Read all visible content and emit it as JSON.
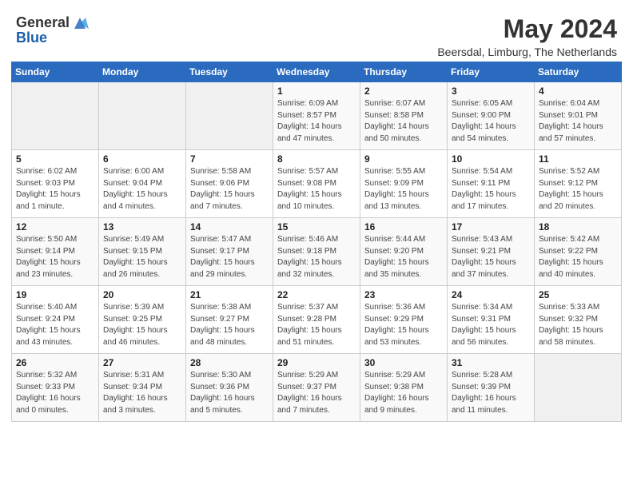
{
  "header": {
    "logo_general": "General",
    "logo_blue": "Blue",
    "month": "May 2024",
    "location": "Beersdal, Limburg, The Netherlands"
  },
  "weekdays": [
    "Sunday",
    "Monday",
    "Tuesday",
    "Wednesday",
    "Thursday",
    "Friday",
    "Saturday"
  ],
  "weeks": [
    [
      {
        "day": "",
        "sunrise": "",
        "sunset": "",
        "daylight": ""
      },
      {
        "day": "",
        "sunrise": "",
        "sunset": "",
        "daylight": ""
      },
      {
        "day": "",
        "sunrise": "",
        "sunset": "",
        "daylight": ""
      },
      {
        "day": "1",
        "sunrise": "Sunrise: 6:09 AM",
        "sunset": "Sunset: 8:57 PM",
        "daylight": "Daylight: 14 hours and 47 minutes."
      },
      {
        "day": "2",
        "sunrise": "Sunrise: 6:07 AM",
        "sunset": "Sunset: 8:58 PM",
        "daylight": "Daylight: 14 hours and 50 minutes."
      },
      {
        "day": "3",
        "sunrise": "Sunrise: 6:05 AM",
        "sunset": "Sunset: 9:00 PM",
        "daylight": "Daylight: 14 hours and 54 minutes."
      },
      {
        "day": "4",
        "sunrise": "Sunrise: 6:04 AM",
        "sunset": "Sunset: 9:01 PM",
        "daylight": "Daylight: 14 hours and 57 minutes."
      }
    ],
    [
      {
        "day": "5",
        "sunrise": "Sunrise: 6:02 AM",
        "sunset": "Sunset: 9:03 PM",
        "daylight": "Daylight: 15 hours and 1 minute."
      },
      {
        "day": "6",
        "sunrise": "Sunrise: 6:00 AM",
        "sunset": "Sunset: 9:04 PM",
        "daylight": "Daylight: 15 hours and 4 minutes."
      },
      {
        "day": "7",
        "sunrise": "Sunrise: 5:58 AM",
        "sunset": "Sunset: 9:06 PM",
        "daylight": "Daylight: 15 hours and 7 minutes."
      },
      {
        "day": "8",
        "sunrise": "Sunrise: 5:57 AM",
        "sunset": "Sunset: 9:08 PM",
        "daylight": "Daylight: 15 hours and 10 minutes."
      },
      {
        "day": "9",
        "sunrise": "Sunrise: 5:55 AM",
        "sunset": "Sunset: 9:09 PM",
        "daylight": "Daylight: 15 hours and 13 minutes."
      },
      {
        "day": "10",
        "sunrise": "Sunrise: 5:54 AM",
        "sunset": "Sunset: 9:11 PM",
        "daylight": "Daylight: 15 hours and 17 minutes."
      },
      {
        "day": "11",
        "sunrise": "Sunrise: 5:52 AM",
        "sunset": "Sunset: 9:12 PM",
        "daylight": "Daylight: 15 hours and 20 minutes."
      }
    ],
    [
      {
        "day": "12",
        "sunrise": "Sunrise: 5:50 AM",
        "sunset": "Sunset: 9:14 PM",
        "daylight": "Daylight: 15 hours and 23 minutes."
      },
      {
        "day": "13",
        "sunrise": "Sunrise: 5:49 AM",
        "sunset": "Sunset: 9:15 PM",
        "daylight": "Daylight: 15 hours and 26 minutes."
      },
      {
        "day": "14",
        "sunrise": "Sunrise: 5:47 AM",
        "sunset": "Sunset: 9:17 PM",
        "daylight": "Daylight: 15 hours and 29 minutes."
      },
      {
        "day": "15",
        "sunrise": "Sunrise: 5:46 AM",
        "sunset": "Sunset: 9:18 PM",
        "daylight": "Daylight: 15 hours and 32 minutes."
      },
      {
        "day": "16",
        "sunrise": "Sunrise: 5:44 AM",
        "sunset": "Sunset: 9:20 PM",
        "daylight": "Daylight: 15 hours and 35 minutes."
      },
      {
        "day": "17",
        "sunrise": "Sunrise: 5:43 AM",
        "sunset": "Sunset: 9:21 PM",
        "daylight": "Daylight: 15 hours and 37 minutes."
      },
      {
        "day": "18",
        "sunrise": "Sunrise: 5:42 AM",
        "sunset": "Sunset: 9:22 PM",
        "daylight": "Daylight: 15 hours and 40 minutes."
      }
    ],
    [
      {
        "day": "19",
        "sunrise": "Sunrise: 5:40 AM",
        "sunset": "Sunset: 9:24 PM",
        "daylight": "Daylight: 15 hours and 43 minutes."
      },
      {
        "day": "20",
        "sunrise": "Sunrise: 5:39 AM",
        "sunset": "Sunset: 9:25 PM",
        "daylight": "Daylight: 15 hours and 46 minutes."
      },
      {
        "day": "21",
        "sunrise": "Sunrise: 5:38 AM",
        "sunset": "Sunset: 9:27 PM",
        "daylight": "Daylight: 15 hours and 48 minutes."
      },
      {
        "day": "22",
        "sunrise": "Sunrise: 5:37 AM",
        "sunset": "Sunset: 9:28 PM",
        "daylight": "Daylight: 15 hours and 51 minutes."
      },
      {
        "day": "23",
        "sunrise": "Sunrise: 5:36 AM",
        "sunset": "Sunset: 9:29 PM",
        "daylight": "Daylight: 15 hours and 53 minutes."
      },
      {
        "day": "24",
        "sunrise": "Sunrise: 5:34 AM",
        "sunset": "Sunset: 9:31 PM",
        "daylight": "Daylight: 15 hours and 56 minutes."
      },
      {
        "day": "25",
        "sunrise": "Sunrise: 5:33 AM",
        "sunset": "Sunset: 9:32 PM",
        "daylight": "Daylight: 15 hours and 58 minutes."
      }
    ],
    [
      {
        "day": "26",
        "sunrise": "Sunrise: 5:32 AM",
        "sunset": "Sunset: 9:33 PM",
        "daylight": "Daylight: 16 hours and 0 minutes."
      },
      {
        "day": "27",
        "sunrise": "Sunrise: 5:31 AM",
        "sunset": "Sunset: 9:34 PM",
        "daylight": "Daylight: 16 hours and 3 minutes."
      },
      {
        "day": "28",
        "sunrise": "Sunrise: 5:30 AM",
        "sunset": "Sunset: 9:36 PM",
        "daylight": "Daylight: 16 hours and 5 minutes."
      },
      {
        "day": "29",
        "sunrise": "Sunrise: 5:29 AM",
        "sunset": "Sunset: 9:37 PM",
        "daylight": "Daylight: 16 hours and 7 minutes."
      },
      {
        "day": "30",
        "sunrise": "Sunrise: 5:29 AM",
        "sunset": "Sunset: 9:38 PM",
        "daylight": "Daylight: 16 hours and 9 minutes."
      },
      {
        "day": "31",
        "sunrise": "Sunrise: 5:28 AM",
        "sunset": "Sunset: 9:39 PM",
        "daylight": "Daylight: 16 hours and 11 minutes."
      },
      {
        "day": "",
        "sunrise": "",
        "sunset": "",
        "daylight": ""
      }
    ]
  ]
}
